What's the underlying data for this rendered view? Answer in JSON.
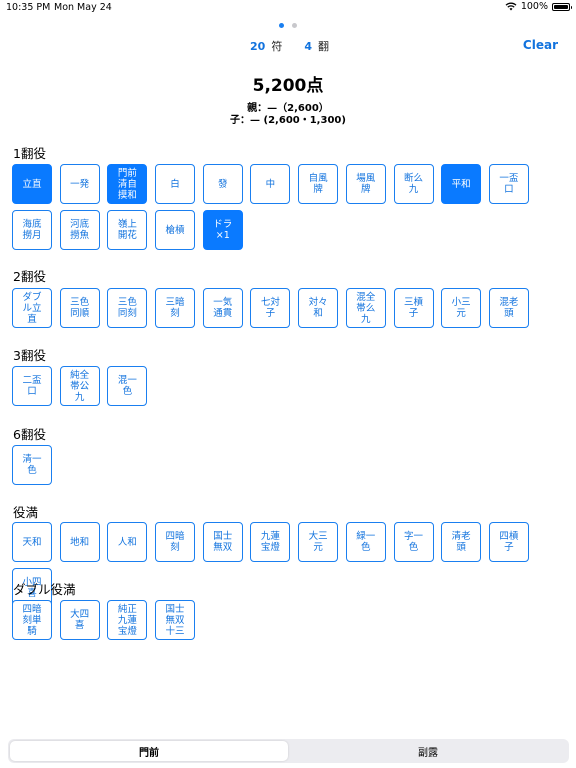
{
  "status": {
    "time": "10:35 PM",
    "date": "Mon May 24",
    "battery": "100%",
    "battery_level": 1.0
  },
  "pager": {
    "pages": 2,
    "current": 1
  },
  "header": {
    "fu_value": "20",
    "fu_unit": "符",
    "han_value": "4",
    "han_unit": "翻",
    "clear_label": "Clear"
  },
  "score": {
    "total": "5,200点",
    "dealer": "親：—（2,600）",
    "child": "子：— (2,600・1,300)"
  },
  "sections": [
    {
      "title": "1翻役",
      "items": [
        {
          "label": "立直",
          "selected": true
        },
        {
          "label": "一発",
          "selected": false
        },
        {
          "label": "門前清自摸和",
          "selected": true
        },
        {
          "label": "白",
          "selected": false
        },
        {
          "label": "發",
          "selected": false
        },
        {
          "label": "中",
          "selected": false
        },
        {
          "label": "自風牌",
          "selected": false
        },
        {
          "label": "場風牌",
          "selected": false
        },
        {
          "label": "断么九",
          "selected": false
        },
        {
          "label": "平和",
          "selected": true
        },
        {
          "label": "一盃口",
          "selected": false
        },
        {
          "label": "海底撈月",
          "selected": false
        },
        {
          "label": "河底撈魚",
          "selected": false
        },
        {
          "label": "嶺上開花",
          "selected": false
        },
        {
          "label": "槍槓",
          "selected": false
        },
        {
          "label": "ドラ×1",
          "selected": true
        }
      ]
    },
    {
      "title": "2翻役",
      "items": [
        {
          "label": "ダブル立直",
          "selected": false
        },
        {
          "label": "三色同順",
          "selected": false
        },
        {
          "label": "三色同刻",
          "selected": false
        },
        {
          "label": "三暗刻",
          "selected": false
        },
        {
          "label": "一気通貫",
          "selected": false
        },
        {
          "label": "七対子",
          "selected": false
        },
        {
          "label": "対々和",
          "selected": false
        },
        {
          "label": "混全帯么九",
          "selected": false
        },
        {
          "label": "三槓子",
          "selected": false
        },
        {
          "label": "小三元",
          "selected": false
        },
        {
          "label": "混老頭",
          "selected": false
        }
      ]
    },
    {
      "title": "3翻役",
      "items": [
        {
          "label": "二盃口",
          "selected": false
        },
        {
          "label": "純全帯公九",
          "selected": false
        },
        {
          "label": "混一色",
          "selected": false
        }
      ]
    },
    {
      "title": "6翻役",
      "items": [
        {
          "label": "清一色",
          "selected": false
        }
      ]
    },
    {
      "title": "役満",
      "items": [
        {
          "label": "天和",
          "selected": false
        },
        {
          "label": "地和",
          "selected": false
        },
        {
          "label": "人和",
          "selected": false
        },
        {
          "label": "四暗刻",
          "selected": false
        },
        {
          "label": "国士無双",
          "selected": false
        },
        {
          "label": "九蓮宝燈",
          "selected": false
        },
        {
          "label": "大三元",
          "selected": false
        },
        {
          "label": "緑一色",
          "selected": false
        },
        {
          "label": "字一色",
          "selected": false
        },
        {
          "label": "清老頭",
          "selected": false
        },
        {
          "label": "四槓子",
          "selected": false
        },
        {
          "label": "小四喜",
          "selected": false
        }
      ]
    },
    {
      "title": "ダブル役満",
      "items": [
        {
          "label": "四暗刻単騎",
          "selected": false
        },
        {
          "label": "大四喜",
          "selected": false
        },
        {
          "label": "純正九蓮宝燈",
          "selected": false
        },
        {
          "label": "国士無双十三",
          "selected": false
        }
      ]
    }
  ],
  "tabs": [
    {
      "label": "門前",
      "active": true
    },
    {
      "label": "副露",
      "active": false
    }
  ],
  "colors": {
    "accent": "#0a7aff",
    "accent_text": "#1273de"
  }
}
